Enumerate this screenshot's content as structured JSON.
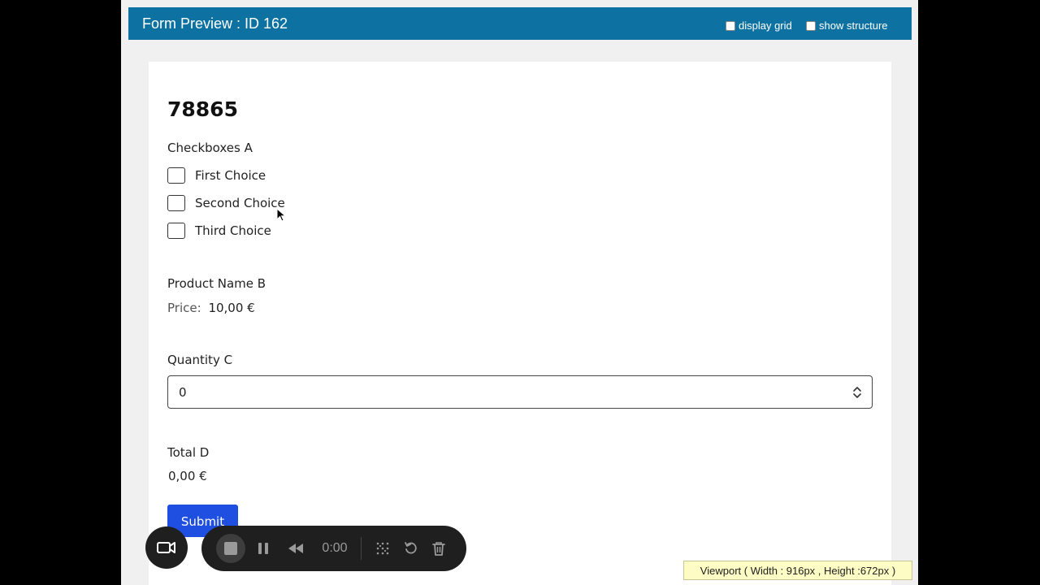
{
  "header": {
    "title": "Form Preview : ID 162",
    "display_grid_label": "display grid",
    "show_structure_label": "show structure"
  },
  "form": {
    "title": "78865",
    "checkboxes": {
      "label": "Checkboxes A",
      "choices": [
        "First Choice",
        "Second Choice",
        "Third Choice"
      ]
    },
    "product": {
      "label": "Product Name B",
      "price_label": "Price:",
      "price_value": "10,00 €"
    },
    "quantity": {
      "label": "Quantity C",
      "value": "0"
    },
    "total": {
      "label": "Total D",
      "value": "0,00 €"
    },
    "submit_label": "Submit"
  },
  "recorder": {
    "time": "0:00"
  },
  "viewport_badge": "Viewport ( Width : 916px , Height :672px )",
  "colors": {
    "header_bg": "#0d72a1",
    "submit_bg": "#1f4fe0",
    "badge_bg": "#fdfcc4"
  }
}
